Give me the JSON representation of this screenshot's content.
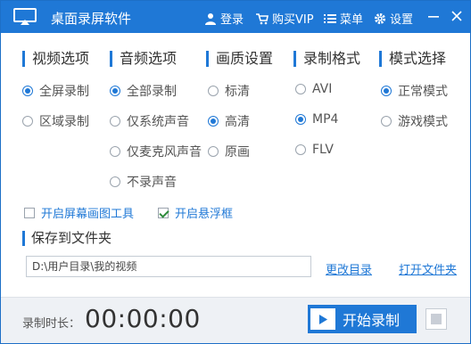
{
  "titlebar": {
    "title": "桌面录屏软件",
    "login": "登录",
    "buy_vip": "购买VIP",
    "menu": "菜单",
    "settings": "设置"
  },
  "sections": {
    "video": {
      "title": "视频选项",
      "options": [
        "全屏录制",
        "区域录制"
      ],
      "selected": "全屏录制"
    },
    "audio": {
      "title": "音频选项",
      "options": [
        "全部录制",
        "仅系统声音",
        "仅麦克风声音",
        "不录声音"
      ],
      "selected": "全部录制"
    },
    "quality": {
      "title": "画质设置",
      "options": [
        "标清",
        "高清",
        "原画"
      ],
      "selected": "高清"
    },
    "format": {
      "title": "录制格式",
      "options": [
        "AVI",
        "MP4",
        "FLV"
      ],
      "selected": "MP4"
    },
    "mode": {
      "title": "模式选择",
      "options": [
        "正常模式",
        "游戏模式"
      ],
      "selected": "正常模式"
    }
  },
  "checks": {
    "draw_tool": {
      "label": "开启屏幕画图工具",
      "checked": false
    },
    "float_box": {
      "label": "开启悬浮框",
      "checked": true
    }
  },
  "save": {
    "title": "保存到文件夹",
    "path": "D:\\用户目录\\我的视频",
    "change_dir": "更改目录",
    "open_folder": "打开文件夹"
  },
  "footer": {
    "duration_label": "录制时长：",
    "duration_value": "00:00:00",
    "start_label": "开始录制"
  },
  "colors": {
    "accent": "#1f78d6",
    "footer_bg": "#eef1f5"
  },
  "icons": [
    "app-screen-icon",
    "user-icon",
    "cart-icon",
    "menu-icon",
    "gear-icon",
    "minimize-icon",
    "close-icon",
    "play-icon",
    "stop-icon"
  ]
}
